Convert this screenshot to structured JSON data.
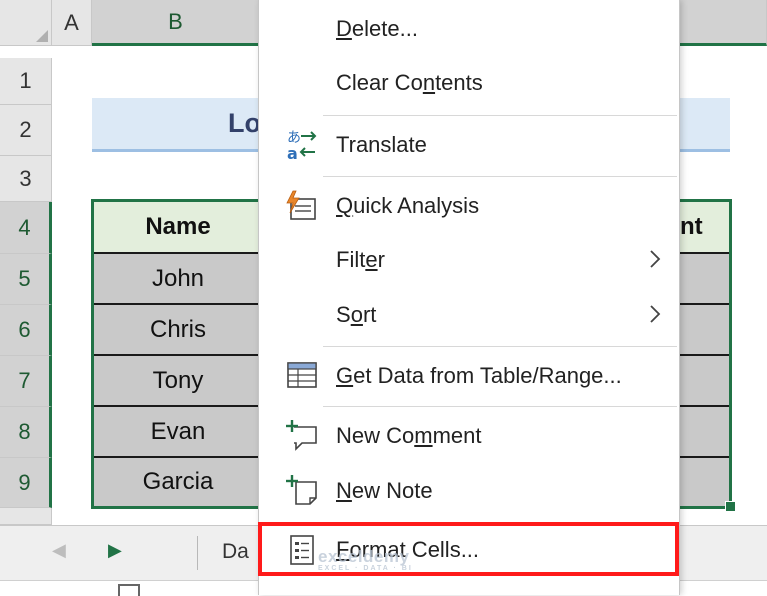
{
  "sheet": {
    "column_headers": [
      "A",
      "B"
    ],
    "row_headers": [
      "1",
      "2",
      "3",
      "4",
      "5",
      "6",
      "7",
      "8",
      "9"
    ],
    "title_text_visible": "Lo",
    "table": {
      "col1_header": "Name",
      "col2_header_partial": "nt",
      "names": [
        "John",
        "Chris",
        "Tony",
        "Evan",
        "Garcia"
      ]
    },
    "colors": {
      "accent": "#217346",
      "title_fill": "#dce9f6",
      "header_fill": "#e3eedc",
      "selected_fill": "#c9c9c9"
    }
  },
  "tabs": {
    "prev_icon": "triangle-left-icon",
    "next_icon": "triangle-right-icon",
    "sheet_tab_partial": "Da"
  },
  "context_menu": {
    "items": {
      "delete": {
        "pre": "",
        "key": "D",
        "post": "elete..."
      },
      "clear": {
        "pre": "Clear Co",
        "key": "n",
        "post": "tents"
      },
      "translate": {
        "pre": "Translate",
        "key": "",
        "post": ""
      },
      "quick": {
        "pre": "",
        "key": "Q",
        "post": "uick Analysis"
      },
      "filter": {
        "pre": "Filt",
        "key": "e",
        "post": "r"
      },
      "sort": {
        "pre": "S",
        "key": "o",
        "post": "rt"
      },
      "getdata": {
        "pre": "",
        "key": "G",
        "post": "et Data from Table/Range..."
      },
      "comment": {
        "pre": "New Co",
        "key": "m",
        "post": "ment"
      },
      "note": {
        "pre": "",
        "key": "N",
        "post": "ew Note"
      },
      "format": {
        "pre": "",
        "key": "F",
        "post": "ormat Cells..."
      }
    },
    "icons": {
      "translate": "translate-icon",
      "quick": "quick-analysis-icon",
      "getdata": "table-range-icon",
      "comment": "new-comment-icon",
      "note": "new-note-icon",
      "format": "format-cells-icon",
      "submenu": "chevron-right-icon"
    },
    "highlight_color": "#ff1a1a"
  },
  "watermark": {
    "name": "exceldemy",
    "tagline": "EXCEL · DATA · BI"
  }
}
